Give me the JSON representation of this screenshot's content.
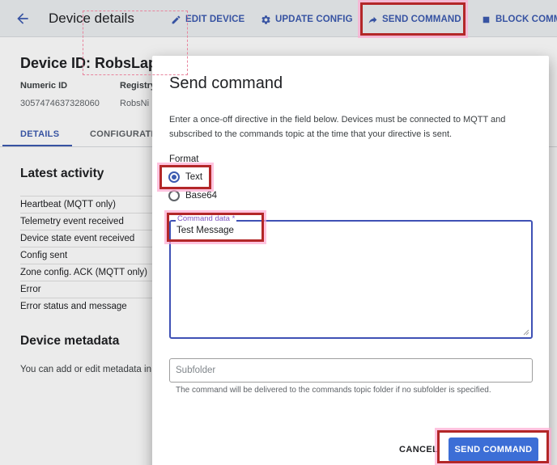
{
  "header": {
    "title": "Device details",
    "actions": {
      "edit": "EDIT DEVICE",
      "update": "UPDATE CONFIG",
      "send": "SEND COMMAND",
      "block": "BLOCK COMMU"
    }
  },
  "device": {
    "id_text": "Device ID: RobsLapto",
    "numeric_id_label": "Numeric ID",
    "numeric_id_value": "3057474637328060",
    "registry_label": "Registry",
    "registry_value": "RobsNi"
  },
  "tabs": {
    "details": "DETAILS",
    "configuration": "CONFIGURATI"
  },
  "latest_activity": {
    "title": "Latest activity",
    "rows": [
      "Heartbeat (MQTT only)",
      "Telemetry event received",
      "Device state event received",
      "Config sent",
      "Zone config. ACK (MQTT only)",
      "Error",
      "Error status and message"
    ]
  },
  "metadata": {
    "title": "Device metadata",
    "text": "You can add or edit metadata in"
  },
  "dialog": {
    "title": "Send command",
    "description": "Enter a once-off directive in the field below. Devices must be connected to MQTT and subscribed to the commands topic at the time that your directive is sent.",
    "format_label": "Format",
    "format_options": [
      "Text",
      "Base64"
    ],
    "selected_format": "Text",
    "command_label": "Command data *",
    "command_value": "Test Message",
    "subfolder_placeholder": "Subfolder",
    "subfolder_hint": "The command will be delivered to the commands topic folder if no subfolder is specified.",
    "cancel_label": "CANCEL",
    "send_label": "SEND COMMAND"
  },
  "colors": {
    "accent": "#3c5bb0",
    "primary_button": "#3c6ed6",
    "highlight": "#b32728",
    "textarea_focus": "#3f51b5"
  }
}
